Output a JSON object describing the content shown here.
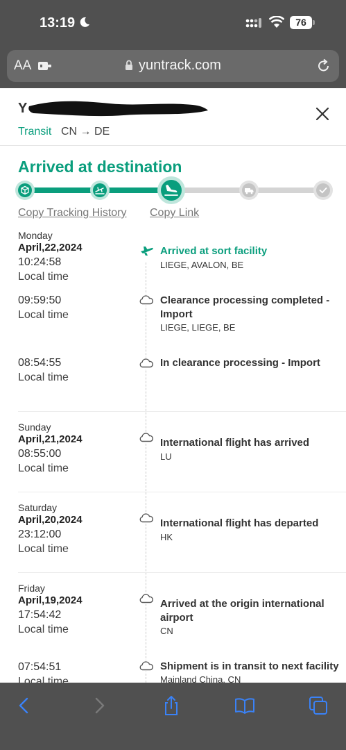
{
  "status_bar": {
    "time": "13:19",
    "battery": "76"
  },
  "browser": {
    "text_size_label": "AA",
    "url": "yuntrack.com"
  },
  "package": {
    "number_prefix": "Y",
    "transit_label": "Transit",
    "route": "CN → DE"
  },
  "status_title": "Arrived at destination",
  "progress": {
    "steps": [
      "box",
      "departure",
      "landing",
      "truck",
      "check"
    ],
    "completed_fraction": 0.5,
    "current_step": 3
  },
  "actions": {
    "copy_history": "Copy Tracking History",
    "copy_link": "Copy Link"
  },
  "local_time_label": "Local time",
  "events": [
    {
      "day": "Monday",
      "date": "April,22,2024",
      "time": "10:24:58",
      "title": "Arrived at sort facility",
      "location": "LIEGE, AVALON, BE",
      "icon": "plane-icon"
    },
    {
      "time": "09:59:50",
      "title": "Clearance processing completed - Import",
      "location": "LIEGE, LIEGE, BE",
      "icon": "cloud-icon"
    },
    {
      "time": "08:54:55",
      "title": "In clearance processing - Import",
      "location": "",
      "icon": "cloud-icon"
    },
    {
      "day": "Sunday",
      "date": "April,21,2024",
      "time": "08:55:00",
      "title": "International flight has arrived",
      "location": "LU",
      "icon": "cloud-icon"
    },
    {
      "day": "Saturday",
      "date": "April,20,2024",
      "time": "23:12:00",
      "title": "International flight has departed",
      "location": "HK",
      "icon": "cloud-icon"
    },
    {
      "day": "Friday",
      "date": "April,19,2024",
      "time": "17:54:42",
      "title": "Arrived at the origin international airport",
      "location": "CN",
      "icon": "cloud-icon"
    },
    {
      "time": "07:54:51",
      "title": "Shipment is in transit to next facility",
      "location": "Mainland China, CN",
      "icon": "cloud-icon"
    }
  ],
  "colors": {
    "accent": "#0a9e7d",
    "chrome": "#505050",
    "ios_blue": "#3a82f7"
  },
  "toolbar_icons": [
    "back-icon",
    "forward-icon",
    "share-icon",
    "bookmarks-icon",
    "tabs-icon"
  ]
}
